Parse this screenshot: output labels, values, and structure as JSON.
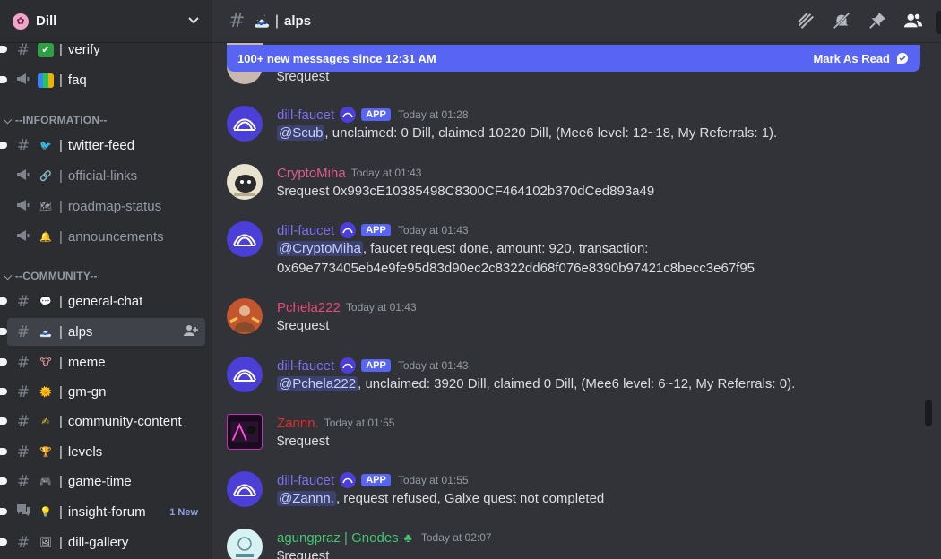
{
  "server": {
    "name": "Dill",
    "icon": "flower-icon"
  },
  "sidebar": {
    "categories": [
      {
        "label": "--INFORMATION--"
      },
      {
        "label": "--COMMUNITY--"
      }
    ],
    "channels": [
      {
        "name": "verify",
        "type": "text",
        "emoji": "✅"
      },
      {
        "name": "faq",
        "type": "announcement",
        "emoji": "📚"
      },
      {
        "name": "twitter-feed",
        "type": "text",
        "emoji": "🐦"
      },
      {
        "name": "official-links",
        "type": "announcement",
        "emoji": "🔗"
      },
      {
        "name": "roadmap-status",
        "type": "announcement",
        "emoji": "🗺"
      },
      {
        "name": "announcements",
        "type": "announcement",
        "emoji": "🔔"
      },
      {
        "name": "general-chat",
        "type": "text",
        "emoji": "💬"
      },
      {
        "name": "alps",
        "type": "text",
        "emoji": "🗻"
      },
      {
        "name": "meme",
        "type": "text",
        "emoji": "🐮"
      },
      {
        "name": "gm-gn",
        "type": "text",
        "emoji": "🌞"
      },
      {
        "name": "community-content",
        "type": "text",
        "emoji": "✍"
      },
      {
        "name": "levels",
        "type": "text",
        "emoji": "🏆"
      },
      {
        "name": "game-time",
        "type": "text",
        "emoji": "🎮"
      },
      {
        "name": "insight-forum",
        "type": "forum",
        "emoji": "💡",
        "badge": "1 New"
      },
      {
        "name": "dill-gallery",
        "type": "text",
        "emoji": "🖼"
      }
    ],
    "separator": "|"
  },
  "header": {
    "channel": "alps",
    "separator": "|",
    "emoji": "🗻"
  },
  "banner": {
    "text": "100+ new messages since 12:31 AM",
    "action": "Mark As Read"
  },
  "messages": [
    {
      "partial": true,
      "text": "$request"
    },
    {
      "user": "dill-faucet",
      "app": "APP",
      "time": "Today at 01:28",
      "mention": "@Scub",
      "text": ", unclaimed: 0 Dill, claimed 10220 Dill, (Mee6 level: 12~18, My Referrals: 1)."
    },
    {
      "user": "CryptoMiha",
      "time": "Today at 01:43",
      "text": "$request 0x993cE10385498C8300CF464102b370dCed893a49"
    },
    {
      "user": "dill-faucet",
      "app": "APP",
      "time": "Today at 01:43",
      "mention": "@CryptoMiha",
      "text": ", faucet request done, amount: 920, transaction:",
      "text2": "0x69e773405eb4e9fe95d83d90ec2c8322dd68f076e8390b97421c8becc3e67f95"
    },
    {
      "user": "Pchela222",
      "time": "Today at 01:43",
      "text": "$request"
    },
    {
      "user": "dill-faucet",
      "app": "APP",
      "time": "Today at 01:43",
      "mention": "@Pchela222",
      "text": ", unclaimed: 3920 Dill, claimed 0 Dill, (Mee6 level: 6~12, My Referrals: 0)."
    },
    {
      "user": "Zannn.",
      "time": "Today at 01:55",
      "text": "$request"
    },
    {
      "user": "dill-faucet",
      "app": "APP",
      "time": "Today at 01:55",
      "mention": "@Zannn.",
      "text": ", request refused, Galxe quest not completed"
    },
    {
      "user": "agungpraz | Gnodes",
      "time": "Today at 02:07",
      "text": "$request"
    }
  ]
}
